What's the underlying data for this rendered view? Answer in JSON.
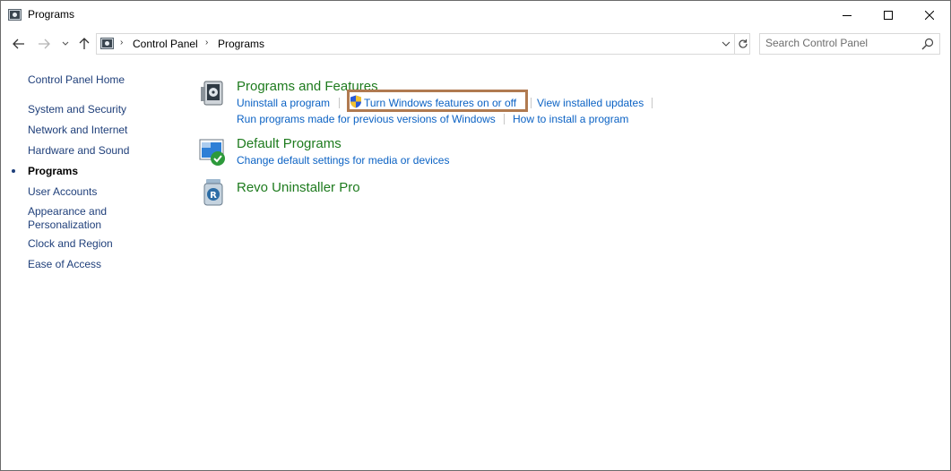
{
  "window": {
    "title": "Programs",
    "icons": {
      "app": "control-panel-icon",
      "minimize": "minimize-icon",
      "maximize": "maximize-icon",
      "close": "close-icon"
    }
  },
  "navigation": {
    "back_icon": "arrow-left-icon",
    "forward_icon": "arrow-right-icon",
    "recent_icon": "chevron-down-icon",
    "up_icon": "arrow-up-icon",
    "breadcrumb": [
      "Control Panel",
      "Programs"
    ],
    "refresh_icon": "refresh-icon",
    "dropdown_icon": "chevron-down-icon"
  },
  "search": {
    "placeholder": "Search Control Panel",
    "value": "",
    "icon": "search-icon"
  },
  "sidebar": {
    "home": "Control Panel Home",
    "items": [
      {
        "label": "System and Security",
        "active": false
      },
      {
        "label": "Network and Internet",
        "active": false
      },
      {
        "label": "Hardware and Sound",
        "active": false
      },
      {
        "label": "Programs",
        "active": true
      },
      {
        "label": "User Accounts",
        "active": false
      },
      {
        "label": "Appearance and Personalization",
        "active": false
      },
      {
        "label": "Clock and Region",
        "active": false
      },
      {
        "label": "Ease of Access",
        "active": false
      }
    ]
  },
  "categories": [
    {
      "title": "Programs and Features",
      "icon": "programs-features-icon",
      "tasks": [
        "Uninstall a program",
        "Turn Windows features on or off",
        "View installed updates",
        "Run programs made for previous versions of Windows",
        "How to install a program"
      ]
    },
    {
      "title": "Default Programs",
      "icon": "default-programs-icon",
      "tasks": [
        "Change default settings for media or devices"
      ]
    },
    {
      "title": "Revo Uninstaller Pro",
      "icon": "revo-uninstaller-icon",
      "tasks": []
    }
  ],
  "colors": {
    "category_title": "#1e7b1e",
    "task_link": "#0b62c4",
    "sidebar_link": "#1f3f7a",
    "highlight_border": "#b07a50"
  }
}
